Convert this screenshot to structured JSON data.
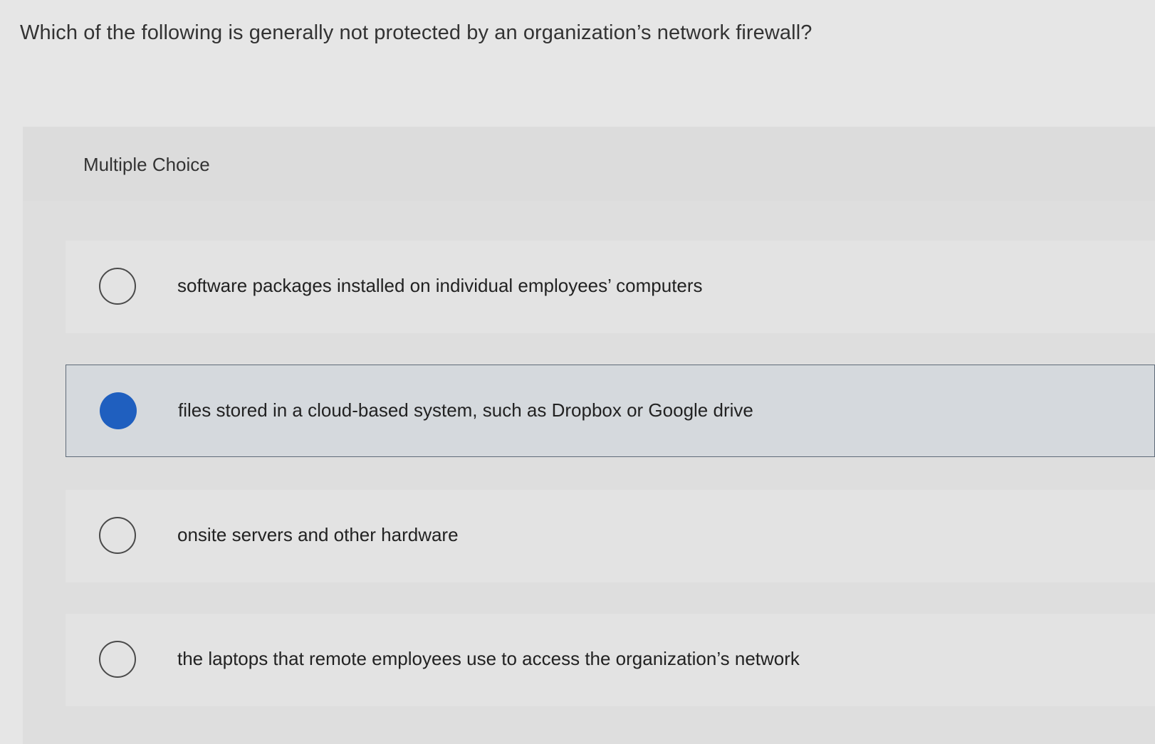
{
  "question": {
    "text": "Which of the following is generally not protected by an organization’s network firewall?"
  },
  "panel": {
    "title": "Multiple Choice"
  },
  "options": [
    {
      "label": "software packages installed on individual employees’ computers",
      "selected": false
    },
    {
      "label": "files stored in a cloud-based system, such as Dropbox or Google drive",
      "selected": true
    },
    {
      "label": "onsite servers and other hardware",
      "selected": false
    },
    {
      "label": "the laptops that remote employees use to access the organization’s network",
      "selected": false
    }
  ],
  "colors": {
    "selected_radio": "#1f5fbf",
    "selected_border": "#5f6b78"
  }
}
